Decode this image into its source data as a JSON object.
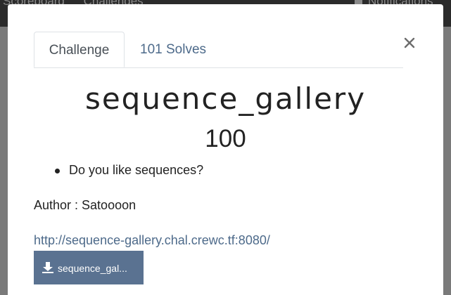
{
  "backdrop": {
    "nav_left_items": [
      "Scoreboard",
      "Challenges"
    ],
    "nav_right_label": "Notifications"
  },
  "modal": {
    "tabs": [
      {
        "label": "Challenge",
        "active": true
      },
      {
        "label": "101 Solves",
        "active": false
      }
    ],
    "close_symbol": "×",
    "challenge_name": "sequence_gallery",
    "challenge_value": "100",
    "description_items": [
      "Do you like sequences?"
    ],
    "author_text": "Author : Satoooon",
    "link_text": "http://sequence-gallery.chal.crewc.tf:8080/",
    "file_button_label": "sequence_gal...",
    "file_button_icon": "download-icon"
  },
  "colors": {
    "link": "#4d6a8a",
    "file_button": "#5a7291",
    "backdrop": "#7f7f7f",
    "navbar": "#2b2b2b"
  }
}
